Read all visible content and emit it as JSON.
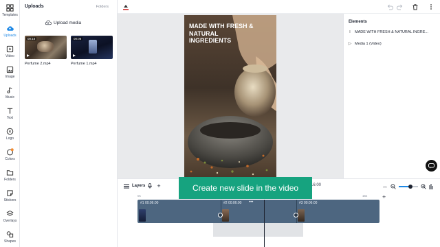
{
  "rail": {
    "items": [
      {
        "label": "Templates",
        "icon": "templates-icon"
      },
      {
        "label": "Uploads",
        "icon": "cloud-upload-icon",
        "active": true
      },
      {
        "label": "Video",
        "icon": "video-icon"
      },
      {
        "label": "Image",
        "icon": "image-icon"
      },
      {
        "label": "Music",
        "icon": "music-icon"
      },
      {
        "label": "Text",
        "icon": "text-icon"
      },
      {
        "label": "Logo",
        "icon": "logo-icon"
      },
      {
        "label": "Colors",
        "icon": "palette-icon",
        "badge": "1"
      },
      {
        "label": "Folders",
        "icon": "folder-icon"
      },
      {
        "label": "Stickers",
        "icon": "sticker-icon"
      },
      {
        "label": "Overlays",
        "icon": "layers-stack-icon"
      },
      {
        "label": "Shapes",
        "icon": "shapes-icon"
      }
    ]
  },
  "uploads": {
    "title": "Uploads",
    "folders_tab": "Folders",
    "upload_button": "Upload media",
    "media": [
      {
        "name": "Perfume 2.mp4",
        "duration": "00:16"
      },
      {
        "name": "Perfume 1.mp4",
        "duration": "00:06"
      }
    ]
  },
  "canvas": {
    "heading": "MADE WITH FRESH & NATURAL INGREDIENTS"
  },
  "elements": {
    "title": "Elements",
    "rows": [
      {
        "icon": "text-element-icon",
        "label": "MADE WITH FRESH & NATURAL INGRE..."
      },
      {
        "icon": "expand-arrow-icon",
        "label": "Media 1 (Video)"
      }
    ]
  },
  "timeline": {
    "layers_label": "Layers",
    "time_readout": "16:00",
    "tooltip": "Create new slide in the video",
    "ruler": [
      "0s",
      "15s"
    ],
    "clips": [
      {
        "label": "#1  00:06:00"
      },
      {
        "label": "#2  00:06:00"
      },
      {
        "label": "#3  00:06:00"
      }
    ],
    "more": "•••",
    "zoom_level": 0.6
  },
  "colors": {
    "accent": "#1e88e5",
    "track": "#4d6680",
    "tooltip_bg": "#16a37f"
  }
}
